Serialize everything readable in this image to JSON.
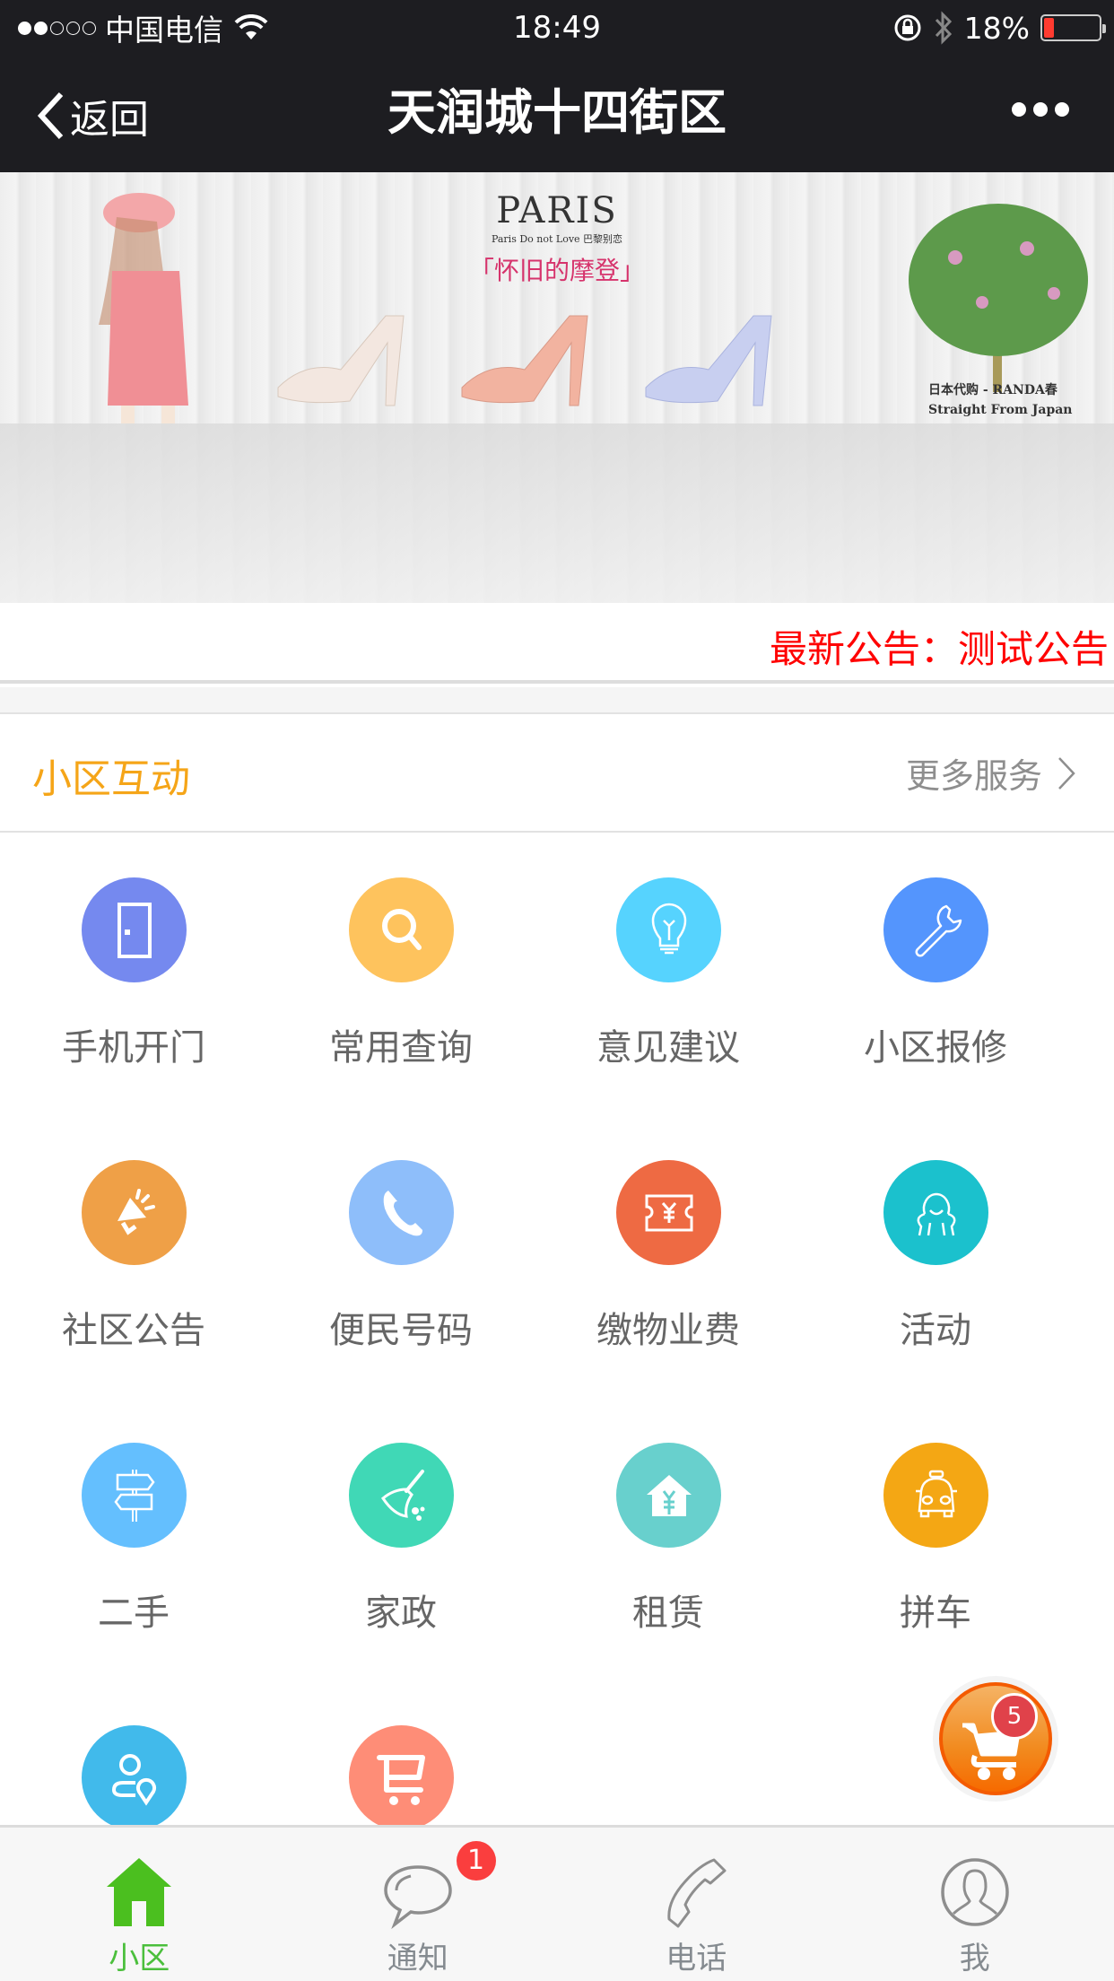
{
  "status_bar": {
    "signal_strength": "2/5",
    "carrier": "中国电信",
    "time": "18:49",
    "battery_percent": "18%",
    "battery_level": 0.18,
    "icons": [
      "wifi-icon",
      "rotation-lock-icon",
      "bluetooth-icon",
      "battery-icon"
    ]
  },
  "nav": {
    "back_label": "返回",
    "title": "天润城十四街区",
    "more_icon": "more-dots-icon"
  },
  "banner": {
    "brand": "PARIS",
    "brand_sub": "Paris Do not Love 巴黎别恋",
    "slogan": "「怀旧的摩登」",
    "tree_caption_1": "日本代购 - RANDA春",
    "tree_caption_2": "Straight From Japan"
  },
  "notice": {
    "text": "最新公告：测试公告"
  },
  "section": {
    "title": "小区互动",
    "more_label": "更多服务",
    "accent_color": "#f5a518"
  },
  "services": [
    {
      "label": "手机开门",
      "icon": "door-icon",
      "color": "#7589ef"
    },
    {
      "label": "常用查询",
      "icon": "search-icon",
      "color": "#fec35d"
    },
    {
      "label": "意见建议",
      "icon": "lightbulb-icon",
      "color": "#56d3fe"
    },
    {
      "label": "小区报修",
      "icon": "wrench-icon",
      "color": "#5495fd"
    },
    {
      "label": "社区公告",
      "icon": "megaphone-icon",
      "color": "#efa047"
    },
    {
      "label": "便民号码",
      "icon": "phone-icon",
      "color": "#8ebefa"
    },
    {
      "label": "缴物业费",
      "icon": "yuan-ticket-icon",
      "color": "#ee6a43"
    },
    {
      "label": "活动",
      "icon": "activity-person-icon",
      "color": "#1bc1cd"
    },
    {
      "label": "二手",
      "icon": "signpost-icon",
      "color": "#64bffe"
    },
    {
      "label": "家政",
      "icon": "broom-icon",
      "color": "#40d8b6"
    },
    {
      "label": "租赁",
      "icon": "house-yuan-icon",
      "color": "#68d0cd"
    },
    {
      "label": "拼车",
      "icon": "taxi-icon",
      "color": "#f4a714"
    },
    {
      "label": "",
      "icon": "person-location-icon",
      "color": "#41baeb"
    },
    {
      "label": "",
      "icon": "cart-icon",
      "color": "#fe8d77"
    }
  ],
  "cart_fab": {
    "count": "5"
  },
  "tabs": [
    {
      "label": "小区",
      "icon": "home-icon",
      "active": true
    },
    {
      "label": "通知",
      "icon": "chat-bubble-icon",
      "badge": "1"
    },
    {
      "label": "电话",
      "icon": "phone-handset-icon"
    },
    {
      "label": "我",
      "icon": "user-profile-icon"
    }
  ],
  "colors": {
    "header_bg": "#1d1d21",
    "notice_text": "#ff0000",
    "tab_active": "#4bbf3c",
    "tab_inactive": "#858b90"
  }
}
